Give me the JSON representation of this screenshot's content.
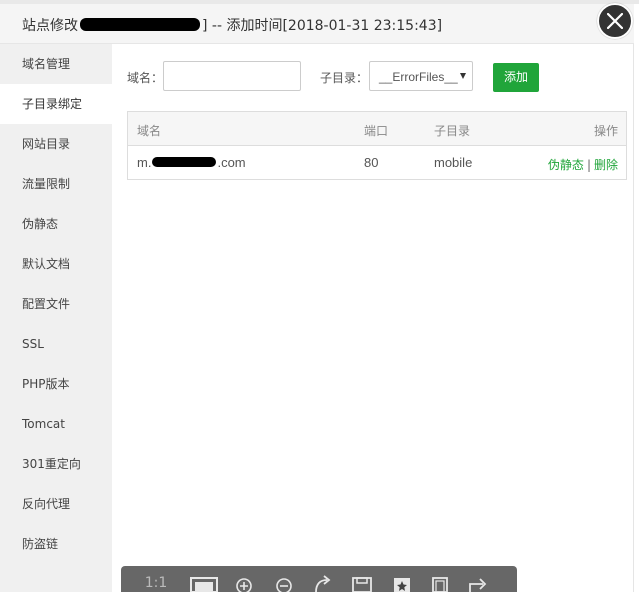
{
  "dialog": {
    "title_prefix": "站点修改",
    "title_suffix": "] -- 添加时间[2018-01-31 23:15:43]"
  },
  "sidebar": {
    "items": [
      {
        "label": "域名管理"
      },
      {
        "label": "子目录绑定"
      },
      {
        "label": "网站目录"
      },
      {
        "label": "流量限制"
      },
      {
        "label": "伪静态"
      },
      {
        "label": "默认文档"
      },
      {
        "label": "配置文件"
      },
      {
        "label": "SSL"
      },
      {
        "label": "PHP版本"
      },
      {
        "label": "Tomcat"
      },
      {
        "label": "301重定向"
      },
      {
        "label": "反向代理"
      },
      {
        "label": "防盗链"
      }
    ],
    "active_index": 1
  },
  "form": {
    "domain_label": "域名：",
    "domain_value": "",
    "subdir_label": "子目录：",
    "subdir_selected": "__ErrorFiles__",
    "add_label": "添加"
  },
  "table": {
    "headers": [
      "域名",
      "端口",
      "子目录",
      "操作"
    ],
    "rows": [
      {
        "domain_prefix": "m.",
        "domain_suffix": ".com",
        "port": "80",
        "subdir": "mobile",
        "op_rewrite": "伪静态",
        "op_sep": "|",
        "op_delete": "删除"
      }
    ]
  },
  "viewer": {
    "one_to_one": "1:1"
  },
  "colors": {
    "accent": "#20a53a",
    "close_bg": "#333333"
  }
}
